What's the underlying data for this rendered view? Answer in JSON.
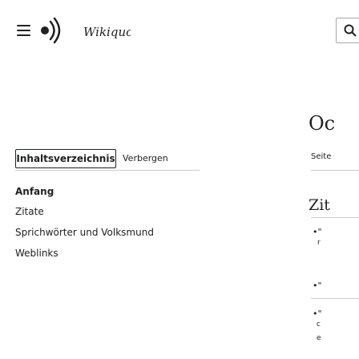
{
  "header": {
    "menu_icon": "hamburger-icon",
    "logo_icon": "wikiquote-logo",
    "logo_text": "Wikiquote",
    "search_icon": "search-icon"
  },
  "toc": {
    "title": "Inhaltsverzeichnis",
    "toggle_label": "Verbergen",
    "items": [
      {
        "label": "Anfang",
        "bold": true
      },
      {
        "label": "Zitate",
        "bold": false
      },
      {
        "label": "Sprichwörter und Volksmund",
        "bold": false
      },
      {
        "label": "Weblinks",
        "bold": false
      }
    ]
  },
  "sidebar": {
    "heading_partial": "Oc",
    "page_label_partial": "Seite",
    "section_heading_partial": "Zit"
  }
}
